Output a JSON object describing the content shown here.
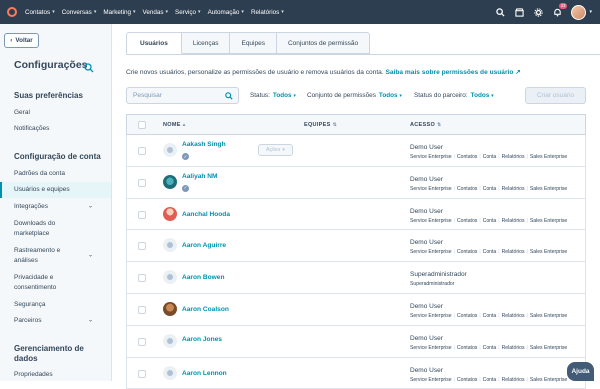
{
  "topnav": {
    "menu": [
      {
        "label": "Contatos"
      },
      {
        "label": "Conversas"
      },
      {
        "label": "Marketing"
      },
      {
        "label": "Vendas"
      },
      {
        "label": "Serviço"
      },
      {
        "label": "Automação"
      },
      {
        "label": "Relatórios"
      }
    ],
    "notifications_count": "23"
  },
  "sidebar": {
    "back_label": "Voltar",
    "title": "Configurações",
    "sections": {
      "prefs": "Suas preferências",
      "account": "Configuração de conta",
      "data": "Gerenciamento de dados"
    },
    "pref_items": [
      "Geral",
      "Notificações"
    ],
    "account_items": [
      {
        "label": "Padrões da conta"
      },
      {
        "label": "Usuários e equipes"
      },
      {
        "label": "Integrações"
      },
      {
        "label": "Downloads do marketplace"
      },
      {
        "label": "Rastreamento e análises"
      },
      {
        "label": "Privacidade e consentimento"
      },
      {
        "label": "Segurança"
      },
      {
        "label": "Parceiros"
      }
    ],
    "data_items": [
      "Propriedades"
    ]
  },
  "tabs": [
    "Usuários",
    "Licenças",
    "Equipes",
    "Conjuntos de permissão"
  ],
  "intro": {
    "text": "Crie novos usuários, personalize as permissões de usuário e remova usuários da conta.",
    "link": "Saiba mais sobre permissões de usuário"
  },
  "toolbar": {
    "search_placeholder": "Pesquisar",
    "filters": {
      "status_label": "Status:",
      "status_value": "Todos",
      "permset_label": "Conjunto de permissões",
      "permset_value": "Todos",
      "partner_label": "Status do parceiro:",
      "partner_value": "Todos"
    },
    "create_label": "Criar usuário"
  },
  "table": {
    "headers": {
      "name": "NOME",
      "teams": "EQUIPES",
      "access": "ACESSO"
    },
    "actions_label": "Ações",
    "access_sub_parts": [
      "Service Enterprise",
      "Contatos",
      "Conta",
      "Relatórios",
      "Sales Enterprise"
    ],
    "rows": [
      {
        "name": "Aakash Singh",
        "access": "Demo User",
        "sub": "Service Enterprise | Contatos | Conta | Relatórios | Sales Enterprise"
      },
      {
        "name": "Aaliyah NM",
        "access": "Demo User",
        "sub": "Service Enterprise | Contatos | Conta | Relatórios | Sales Enterprise"
      },
      {
        "name": "Aanchal Hooda",
        "access": "Demo User",
        "sub": "Service Enterprise | Contatos | Conta | Relatórios | Sales Enterprise"
      },
      {
        "name": "Aaron Aguirre",
        "access": "Demo User",
        "sub": "Service Enterprise | Contatos | Conta | Relatórios | Sales Enterprise"
      },
      {
        "name": "Aaron Bowen",
        "access": "Superadministrador",
        "sub": "Superadministrador"
      },
      {
        "name": "Aaron Coalson",
        "access": "Demo User",
        "sub": "Service Enterprise | Contatos | Conta | Relatórios | Sales Enterprise"
      },
      {
        "name": "Aaron Jones",
        "access": "Demo User",
        "sub": "Service Enterprise | Contatos | Conta | Relatórios | Sales Enterprise"
      },
      {
        "name": "Aaron Lennon",
        "access": "Demo User",
        "sub": "Service Enterprise | Contatos | Conta | Relatórios | Sales Enterprise"
      }
    ]
  },
  "help_label": "Ajuda",
  "colors": {
    "nav": "#2d3e50",
    "accent": "#0091ae",
    "text": "#33475b",
    "brand": "#ff7a59"
  }
}
